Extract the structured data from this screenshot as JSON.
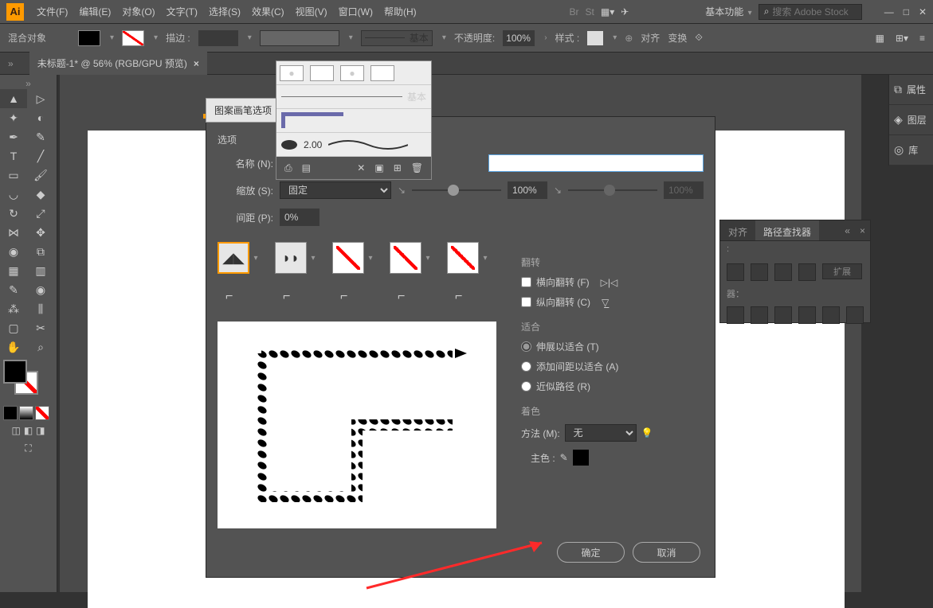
{
  "menubar": {
    "file": "文件(F)",
    "edit": "编辑(E)",
    "object": "对象(O)",
    "type": "文字(T)",
    "select": "选择(S)",
    "effect": "效果(C)",
    "view": "视图(V)",
    "window": "窗口(W)",
    "help": "帮助(H)"
  },
  "workspace_switcher": "基本功能",
  "search_placeholder": "搜索 Adobe Stock",
  "optionbar": {
    "blend": "混合对象",
    "stroke": "描边 :",
    "brush_label": "基本",
    "opacity": "不透明度:",
    "opacity_val": "100%",
    "style": "样式 :",
    "align": "对齐",
    "transform": "变换"
  },
  "doc_tab": "未标题-1* @ 56% (RGB/GPU 预览)",
  "brush_popup": {
    "basic": "基本",
    "val": "2.00"
  },
  "dialog": {
    "tab": "图案画笔选项",
    "options": "选项",
    "name": "名称 (N):",
    "name_val": "",
    "scale": "缩放 (S):",
    "scale_mode": "固定",
    "scale_val": "100%",
    "scale_val2": "100%",
    "spacing": "间距 (P):",
    "spacing_val": "0%",
    "flip": "翻转",
    "flip_h": "横向翻转 (F)",
    "flip_v": "纵向翻转 (C)",
    "fit": "适合",
    "fit_stretch": "伸展以适合 (T)",
    "fit_space": "添加间距以适合 (A)",
    "fit_approx": "近似路径 (R)",
    "colorize": "着色",
    "method": "方法 (M):",
    "method_val": "无",
    "key_color": "主色 :",
    "ok": "确定",
    "cancel": "取消"
  },
  "right_tabs": {
    "properties": "属性",
    "layers": "图层",
    "libraries": "库"
  },
  "float_panel": {
    "align": "对齐",
    "pathfinder": "路径查找器",
    "expand": "扩展",
    "section": "器："
  }
}
